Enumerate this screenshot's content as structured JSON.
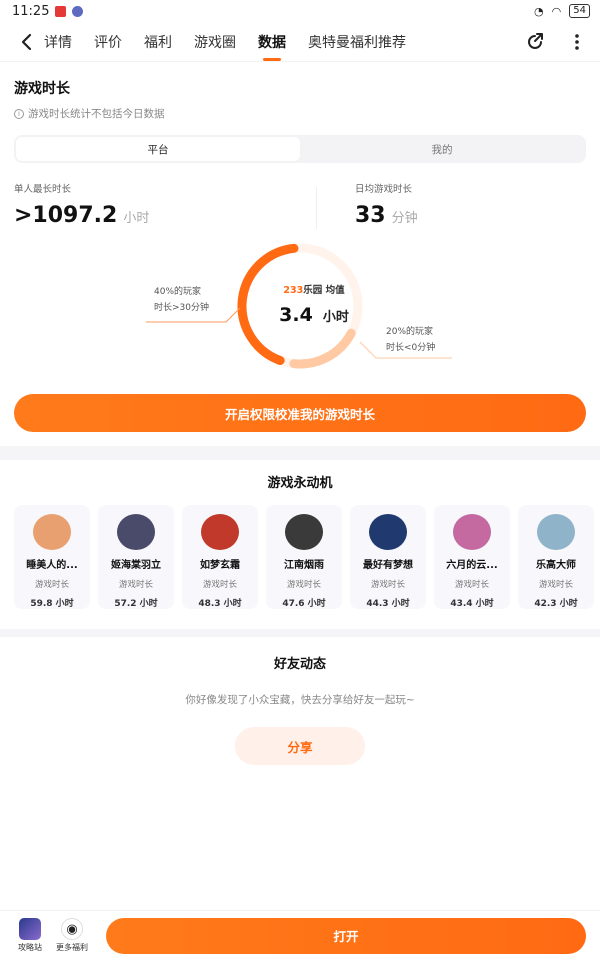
{
  "status": {
    "time": "11:25",
    "battery": "54"
  },
  "tabs": [
    "详情",
    "评价",
    "福利",
    "游戏圈",
    "数据",
    "奥特曼福利推荐"
  ],
  "active_tab": "数据",
  "play_time": {
    "title": "游戏时长",
    "note": "游戏时长统计不包括今日数据",
    "segments": [
      "平台",
      "我的"
    ],
    "left": {
      "label": "单人最长时长",
      "value": ">1097.2",
      "unit": "小时"
    },
    "right": {
      "label": "日均游戏时长",
      "value": "33",
      "unit": "分钟"
    },
    "donut": {
      "brand": "233",
      "brand_suffix": "乐园 均值",
      "value": "3.4",
      "unit": "小时",
      "callout_left_1": "40%的玩家",
      "callout_left_2": "时长>30分钟",
      "callout_right_1": "20%的玩家",
      "callout_right_2": "时长<0分钟",
      "share_over_30": 0.4,
      "share_under_0": 0.2
    },
    "cta": "开启权限校准我的游戏时长"
  },
  "perpetual": {
    "title": "游戏永动机",
    "players": [
      {
        "name": "睡美人的...",
        "label": "游戏时长",
        "hours": "59.8 小时",
        "color": "#e8a070"
      },
      {
        "name": "姬海棠羽立",
        "label": "游戏时长",
        "hours": "57.2 小时",
        "color": "#4a4a6a"
      },
      {
        "name": "如梦玄霜",
        "label": "游戏时长",
        "hours": "48.3 小时",
        "color": "#c0392b"
      },
      {
        "name": "江南烟雨",
        "label": "游戏时长",
        "hours": "47.6 小时",
        "color": "#3a3a3a"
      },
      {
        "name": "最好有梦想",
        "label": "游戏时长",
        "hours": "44.3 小时",
        "color": "#203a70"
      },
      {
        "name": "六月的云...",
        "label": "游戏时长",
        "hours": "43.4 小时",
        "color": "#c46aa0"
      },
      {
        "name": "乐高大师",
        "label": "游戏时长",
        "hours": "42.3 小时",
        "color": "#8fb3c9"
      }
    ]
  },
  "friends": {
    "title": "好友动态",
    "hint": "你好像发现了小众宝藏，快去分享给好友一起玩~",
    "share": "分享"
  },
  "bottom": {
    "guide": "攻略站",
    "more": "更多福利",
    "open": "打开"
  },
  "colors": {
    "accent": "#ff6a13",
    "accent_light": "#ffc9a3"
  }
}
